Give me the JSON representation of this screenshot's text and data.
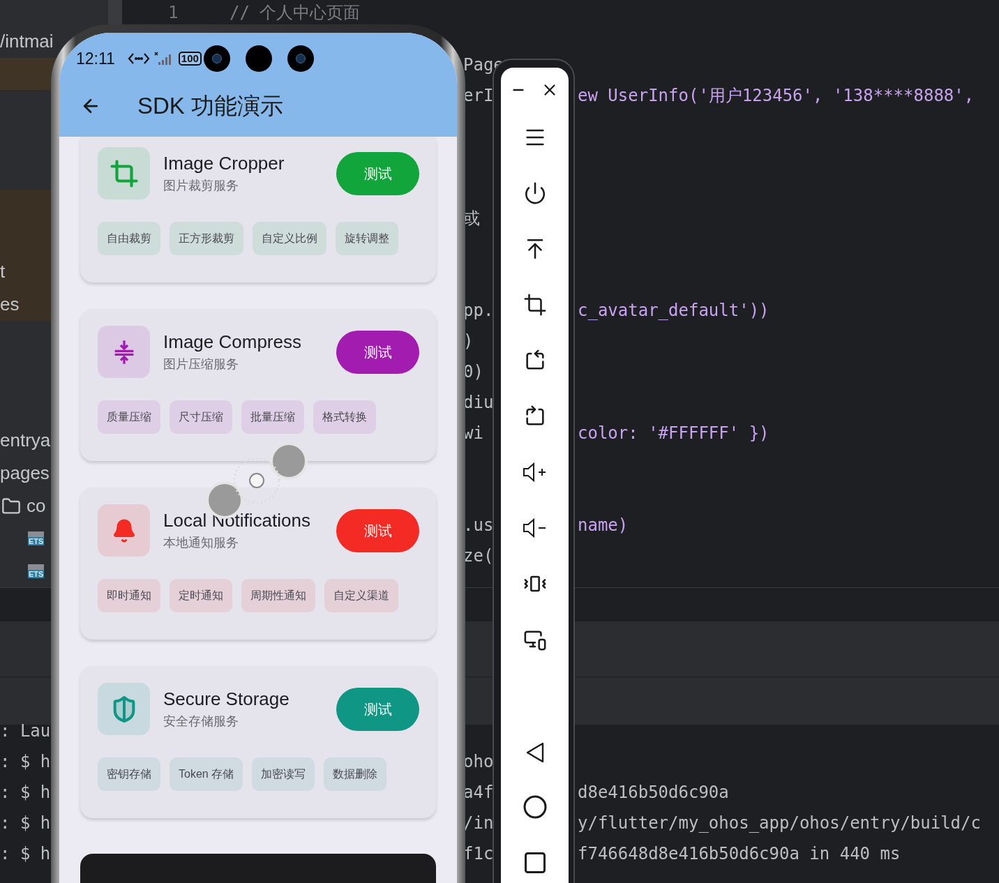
{
  "ide": {
    "gutter_line_number": "1",
    "top_comment": "// 个人中心页面",
    "sidebar": {
      "top_path": "/intmai",
      "highlighted_items": [
        "t",
        "es"
      ],
      "items": [
        "entrya",
        "pages"
      ],
      "folder_item": "co",
      "file_badges": [
        "ETS",
        "ETS"
      ]
    },
    "code_lines": [
      {
        "left": "Page"
      },
      {
        "left": "erI",
        "right": "ew UserInfo('用户123456', '138****8888',"
      },
      {
        "left": "或"
      },
      {
        "left": "pp.",
        "right": "c_avatar_default'))"
      },
      {
        "left": ")"
      },
      {
        "left": "0)"
      },
      {
        "left": "diu"
      },
      {
        "left": "wi",
        "right": "color: '#FFFFFF' })"
      },
      {
        "left": ".us",
        "right": "name)"
      },
      {
        "left": "ze("
      }
    ],
    "terminal": [
      {
        "prompt": ": Lau"
      },
      {
        "prompt": ": $ h",
        "left": "oho"
      },
      {
        "prompt": ": $ h",
        "left": "a4f",
        "right": "d8e416b50d6c90a"
      },
      {
        "prompt": ": $ h",
        "left": "/in",
        "right": "y/flutter/my_ohos_app/ohos/entry/build/c"
      },
      {
        "prompt": ": $ h",
        "left": "f1c",
        "right": "f746648d8e416b50d6c90a in 440 ms"
      }
    ]
  },
  "phone": {
    "status_bar": {
      "time": "12:11",
      "battery": "100"
    },
    "app_bar": {
      "title": "SDK 功能演示"
    },
    "cards": [
      {
        "kind": "crop",
        "title": "Image Cropper",
        "subtitle": "图片裁剪服务",
        "color": "#12a53c",
        "button": "测试",
        "chips": [
          "自由裁剪",
          "正方形裁剪",
          "自定义比例",
          "旋转调整"
        ]
      },
      {
        "kind": "compress",
        "title": "Image Compress",
        "subtitle": "图片压缩服务",
        "color": "#a21caf",
        "button": "测试",
        "chips": [
          "质量压缩",
          "尺寸压缩",
          "批量压缩",
          "格式转换"
        ]
      },
      {
        "kind": "bell",
        "title": "Local Notifications",
        "subtitle": "本地通知服务",
        "color": "#f42b24",
        "button": "测试",
        "chips": [
          "即时通知",
          "定时通知",
          "周期性通知",
          "自定义渠道"
        ]
      },
      {
        "kind": "shield",
        "title": "Secure Storage",
        "subtitle": "安全存储服务",
        "color": "#0f9684",
        "button": "测试",
        "chips": [
          "密钥存储",
          "Token 存储",
          "加密读写",
          "数据删除"
        ]
      }
    ]
  }
}
